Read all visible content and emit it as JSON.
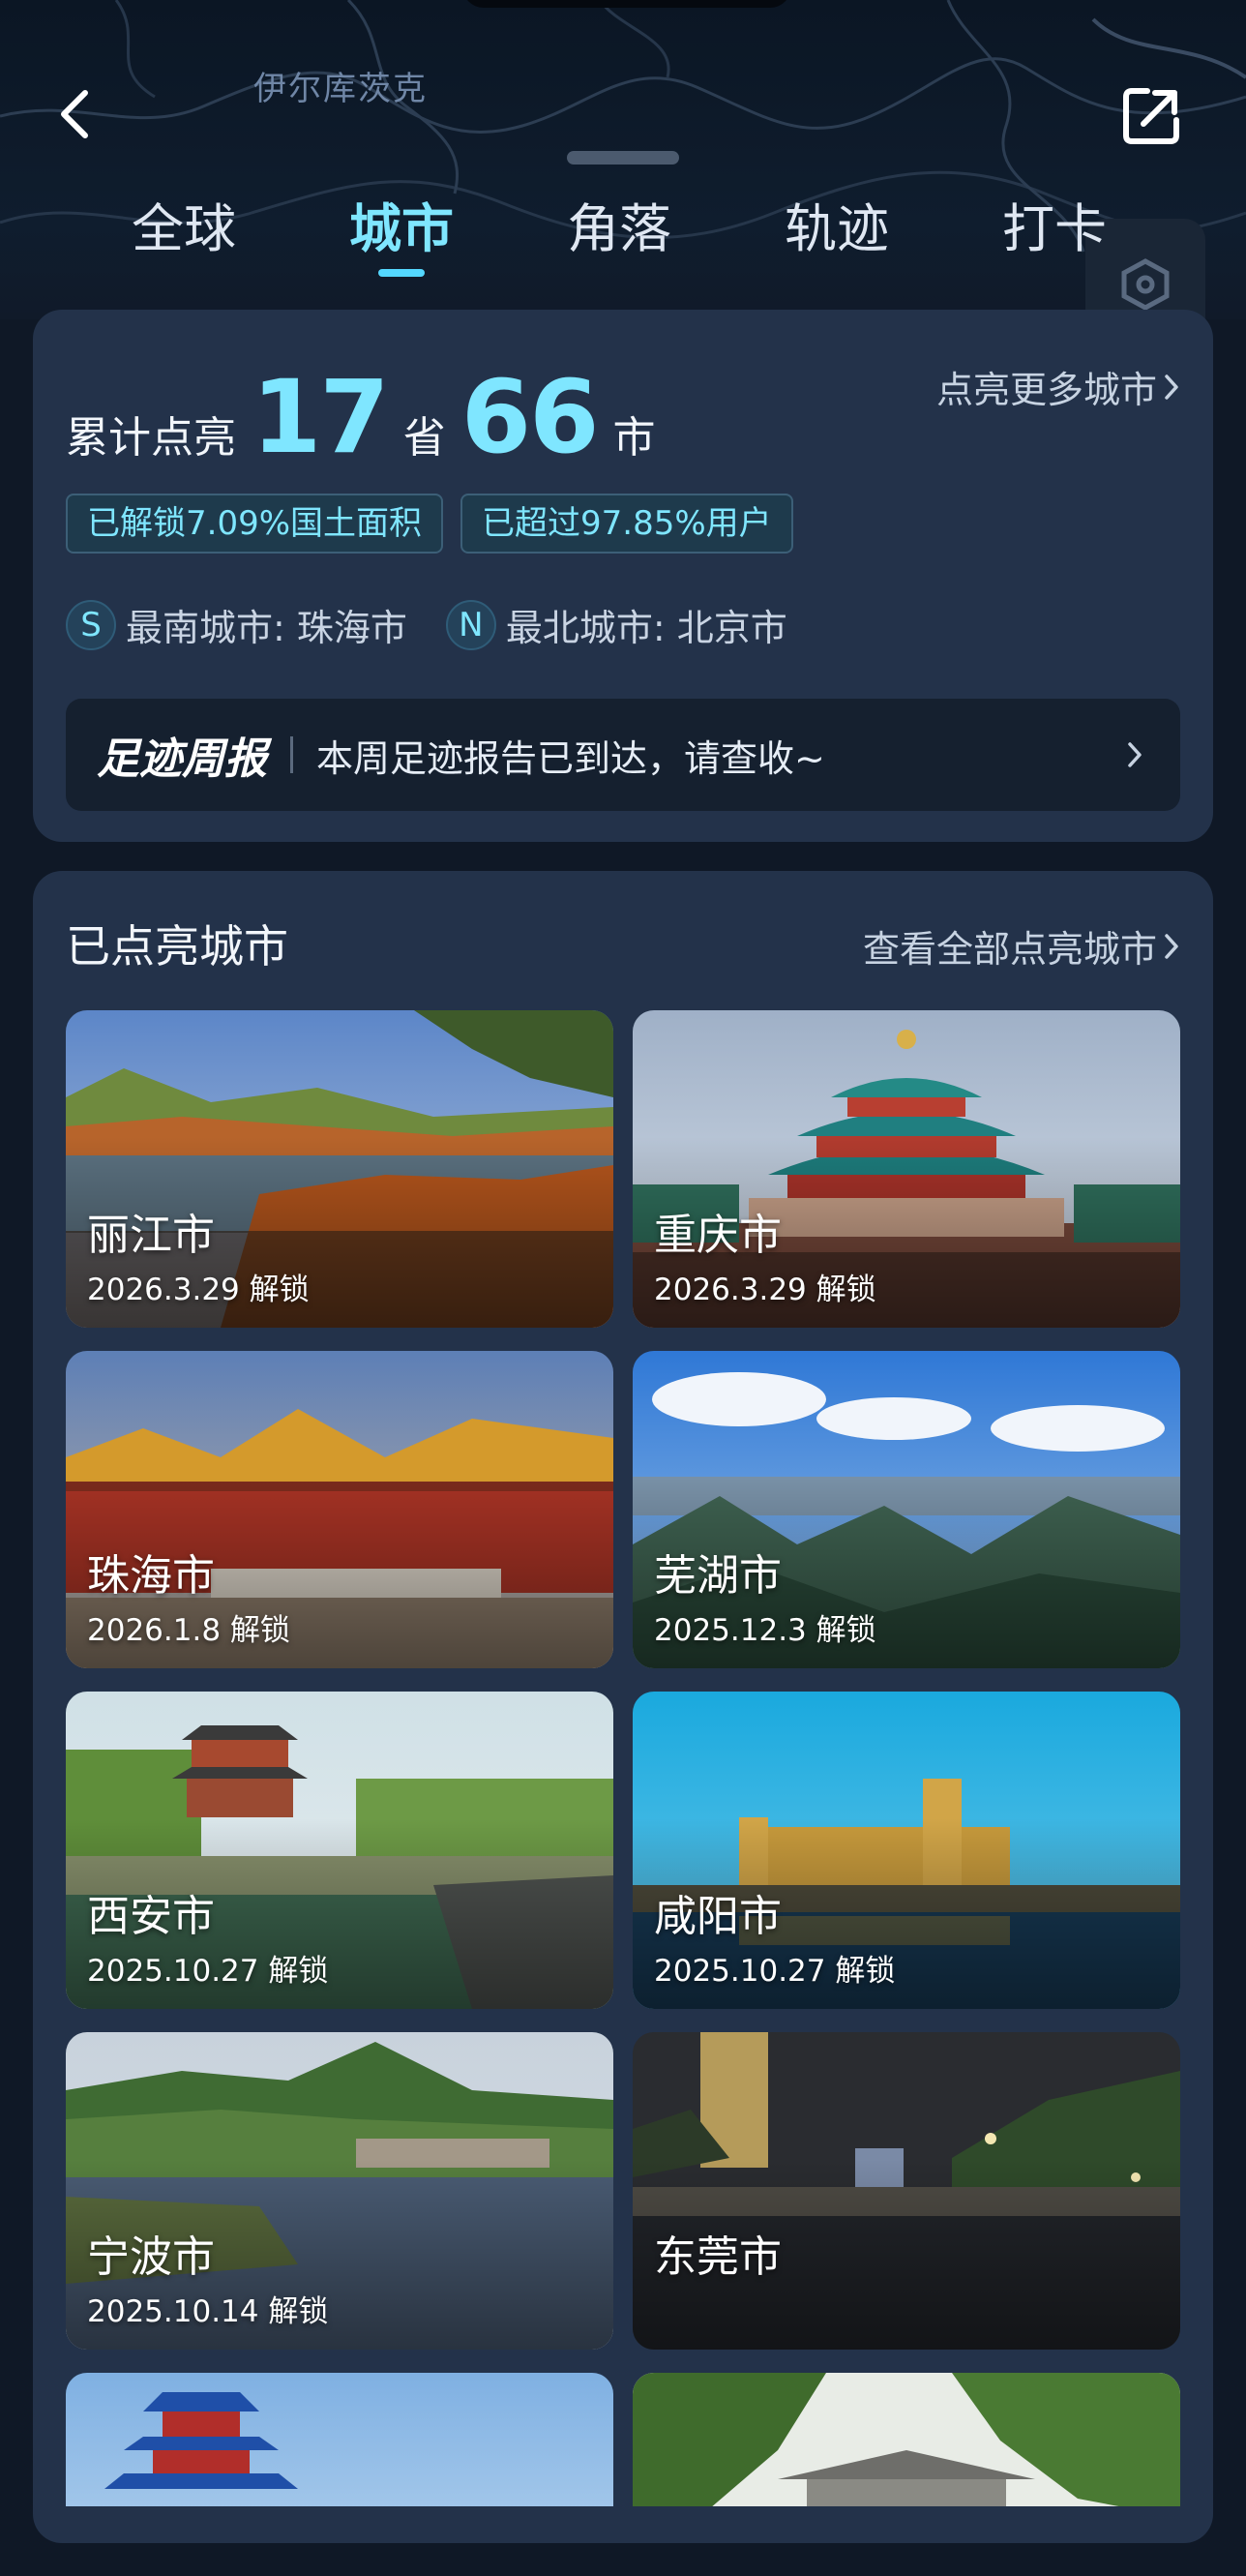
{
  "map": {
    "place_label": "伊尔库茨克"
  },
  "tabs": [
    {
      "label": "全球"
    },
    {
      "label": "城市"
    },
    {
      "label": "角落"
    },
    {
      "label": "轨迹"
    },
    {
      "label": "打卡"
    }
  ],
  "active_tab": "城市",
  "summary": {
    "prefix": "累计点亮",
    "province_count": "17",
    "province_unit": "省",
    "city_count": "66",
    "city_unit": "市",
    "more_link": "点亮更多城市",
    "chips": [
      "已解锁7.09%国土面积",
      "已超过97.85%用户"
    ],
    "south_badge": "S",
    "south_text": "最南城市: 珠海市",
    "north_badge": "N",
    "north_text": "最北城市: 北京市",
    "weekly_title": "足迹周报",
    "weekly_text": "本周足迹报告已到达，请查收~"
  },
  "cities": {
    "title": "已点亮城市",
    "view_all": "查看全部点亮城市",
    "items": [
      {
        "name": "丽江市",
        "date": "2026.3.29 解锁"
      },
      {
        "name": "重庆市",
        "date": "2026.3.29 解锁"
      },
      {
        "name": "珠海市",
        "date": "2026.1.8 解锁"
      },
      {
        "name": "芜湖市",
        "date": "2025.12.3 解锁"
      },
      {
        "name": "西安市",
        "date": "2025.10.27 解锁"
      },
      {
        "name": "咸阳市",
        "date": "2025.10.27 解锁"
      },
      {
        "name": "宁波市",
        "date": "2025.10.14 解锁"
      },
      {
        "name": "东莞市",
        "date": ""
      },
      {
        "name": "",
        "date": ""
      },
      {
        "name": "",
        "date": ""
      }
    ]
  },
  "colors": {
    "accent": "#7fe6ff",
    "card": "#23324a",
    "background": "#0f1826"
  },
  "icons": {
    "back": "chevron-left-icon",
    "share": "share-icon",
    "locate": "locate-hexagon-icon",
    "more": "chevron-right-icon"
  }
}
